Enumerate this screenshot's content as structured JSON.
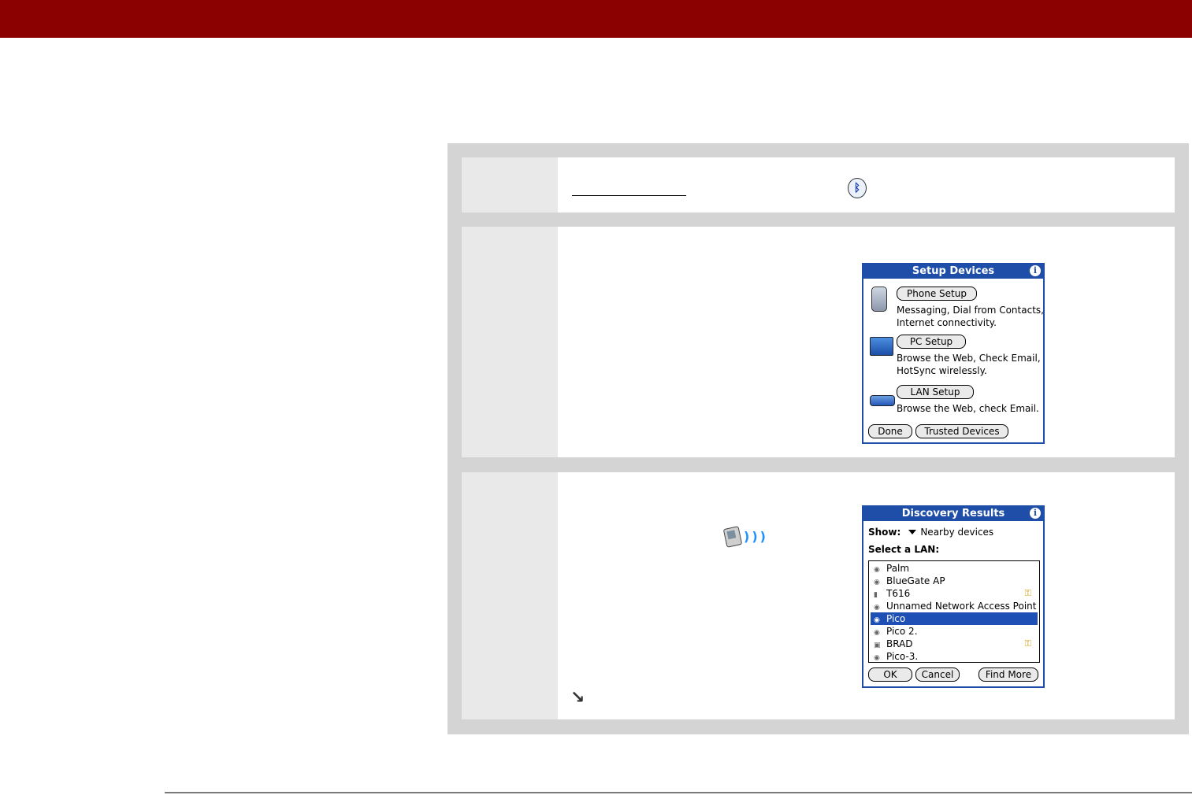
{
  "colors": {
    "header_bar": "#8b0000",
    "palm_title": "#1f4ea8",
    "selection": "#1e4fb5"
  },
  "setup_devices": {
    "title": "Setup Devices",
    "info": "i",
    "phone_button": "Phone Setup",
    "phone_desc_1": "Messaging, Dial from Contacts,",
    "phone_desc_2": "Internet connectivity.",
    "pc_button": "PC Setup",
    "pc_desc_1": "Browse the Web, Check Email,",
    "pc_desc_2": "HotSync wirelessly.",
    "lan_button": "LAN Setup",
    "lan_desc": "Browse the Web, check Email.",
    "done_button": "Done",
    "trusted_button": "Trusted Devices"
  },
  "discovery": {
    "title": "Discovery Results",
    "info": "i",
    "show_label": "Show:",
    "show_value": "Nearby devices",
    "select_label": "Select a LAN:",
    "items": [
      {
        "name": "Palm",
        "icon": "wifi-icon"
      },
      {
        "name": "BlueGate AP",
        "icon": "wifi-icon"
      },
      {
        "name": "T616",
        "icon": "phone-icon"
      },
      {
        "name": "Unnamed Network Access Point",
        "icon": "wifi-icon"
      },
      {
        "name": "Pico",
        "icon": "wifi-icon"
      },
      {
        "name": "Pico 2.",
        "icon": "wifi-icon"
      },
      {
        "name": "BRAD",
        "icon": "pc-icon"
      },
      {
        "name": "Pico-3.",
        "icon": "wifi-icon"
      }
    ],
    "ok_button": "OK",
    "cancel_button": "Cancel",
    "find_more_button": "Find More"
  }
}
